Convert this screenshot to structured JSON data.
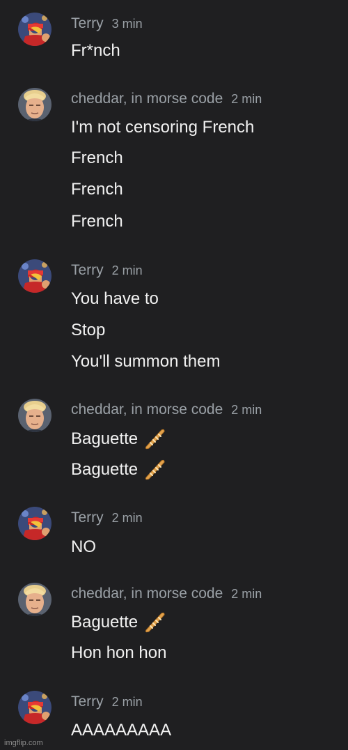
{
  "messages": [
    {
      "author": "Terry",
      "time": "3 min",
      "avatar": "terry",
      "lines": [
        "Fr*nch"
      ]
    },
    {
      "author": "cheddar, in morse code",
      "time": "2 min",
      "avatar": "cheddar",
      "lines": [
        "I'm not censoring French",
        "French",
        "French",
        "French"
      ]
    },
    {
      "author": "Terry",
      "time": "2 min",
      "avatar": "terry",
      "lines": [
        "You have to",
        "Stop",
        "You'll summon them"
      ]
    },
    {
      "author": "cheddar, in morse code",
      "time": "2 min",
      "avatar": "cheddar",
      "lines": [
        "Baguette",
        "Baguette"
      ],
      "emoji": "baguette-icon"
    },
    {
      "author": "Terry",
      "time": "2 min",
      "avatar": "terry",
      "lines": [
        "NO"
      ]
    },
    {
      "author": "cheddar, in morse code",
      "time": "2 min",
      "avatar": "cheddar",
      "lines": [
        "Baguette",
        "Hon hon hon"
      ],
      "emoji_on_first_line": "baguette-icon"
    },
    {
      "author": "Terry",
      "time": "2 min",
      "avatar": "terry",
      "lines": [
        "AAAAAAAAA"
      ]
    }
  ],
  "watermark": "imgflip.com",
  "colors": {
    "background": "#1f1f21",
    "meta_text": "#9aa0a6",
    "message_text": "#f1f1f1"
  }
}
